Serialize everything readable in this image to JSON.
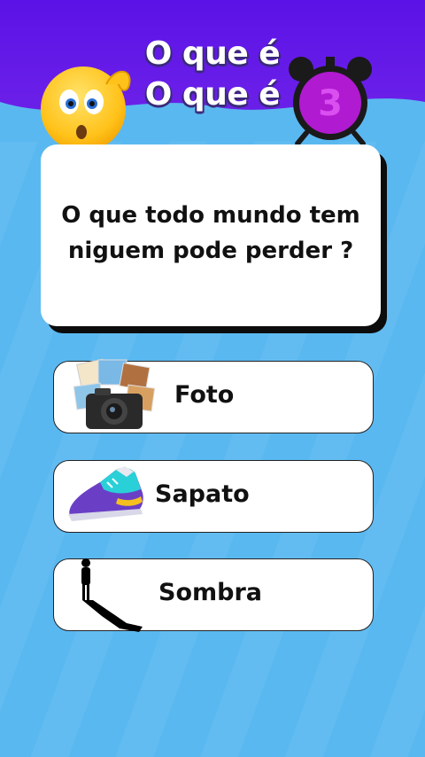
{
  "header": {
    "title_line1": "O que é",
    "title_line2": "O que é",
    "timer_value": "3"
  },
  "question": {
    "text": "O que todo mundo tem niguem pode perder ?"
  },
  "answers": [
    {
      "label": "Foto",
      "icon": "camera-photos-icon"
    },
    {
      "label": "Sapato",
      "icon": "sneaker-icon"
    },
    {
      "label": "Sombra",
      "icon": "shadow-silhouette-icon"
    }
  ],
  "colors": {
    "header_purple": "#5b12e6",
    "background_blue": "#5ab8f0",
    "card_white": "#ffffff",
    "timer_magenta": "#b01ad0"
  }
}
